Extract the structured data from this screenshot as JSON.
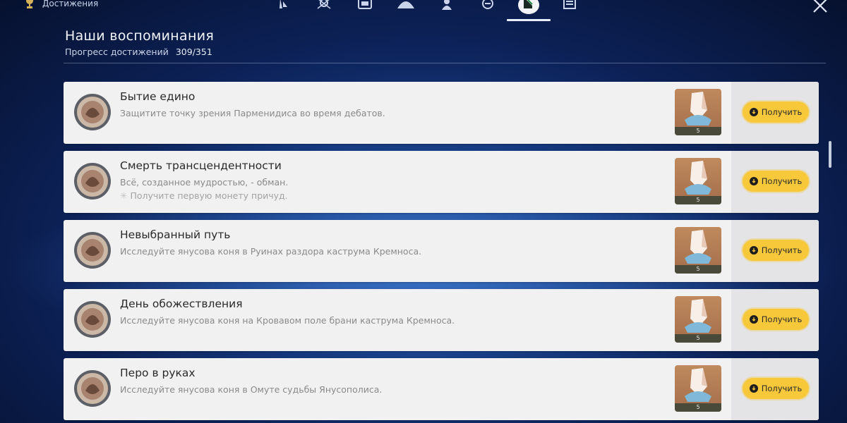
{
  "topbar": {
    "section_label": "Достижения",
    "tabs": [
      {
        "icon": "tab-icon-1",
        "active": false
      },
      {
        "icon": "tab-icon-2",
        "active": false
      },
      {
        "icon": "tab-icon-3",
        "active": false
      },
      {
        "icon": "tab-icon-4",
        "active": false
      },
      {
        "icon": "tab-icon-5",
        "active": false
      },
      {
        "icon": "tab-icon-6",
        "active": false
      },
      {
        "icon": "tab-icon-7",
        "active": true
      },
      {
        "icon": "tab-icon-8",
        "active": false
      }
    ]
  },
  "header": {
    "title": "Наши воспоминания",
    "progress_label": "Прогресс достижений",
    "progress_value": "309/351"
  },
  "achievements": [
    {
      "title": "Бытие едино",
      "description": "Защитите точку зрения Парменидиса во время дебатов.",
      "hint": "",
      "reward_count": "5",
      "button_label": "Получить"
    },
    {
      "title": "Смерть трансцендентности",
      "description": "Всё, созданное мудростью, - обман.",
      "hint": "Получите первую монету причуд.",
      "reward_count": "5",
      "button_label": "Получить"
    },
    {
      "title": "Невыбранный путь",
      "description": "Исследуйте янусова коня в Руинах раздора каструма Кремноса.",
      "hint": "",
      "reward_count": "5",
      "button_label": "Получить"
    },
    {
      "title": "День обожествления",
      "description": "Исследуйте янусова коня на Кровавом поле брани каструма Кремноса.",
      "hint": "",
      "reward_count": "5",
      "button_label": "Получить"
    },
    {
      "title": "Перо в руках",
      "description": "Исследуйте янусова коня в Омуте судьбы Янусополиса.",
      "hint": "",
      "reward_count": "5",
      "button_label": "Получить"
    }
  ],
  "colors": {
    "button": "#f6c83a",
    "row_bg": "#f1f1f1",
    "background": "#173d84"
  }
}
